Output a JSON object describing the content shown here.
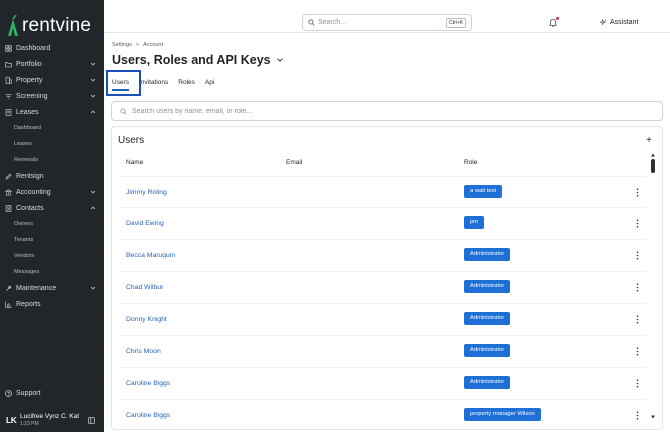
{
  "app": {
    "name": "rentvine"
  },
  "sidebar": {
    "items": [
      {
        "label": "Dashboard",
        "icon": "grid-icon",
        "chevron": ""
      },
      {
        "label": "Portfolio",
        "icon": "folder-icon",
        "chevron": "down"
      },
      {
        "label": "Property",
        "icon": "building-icon",
        "chevron": "down"
      },
      {
        "label": "Screening",
        "icon": "filter-icon",
        "chevron": "down"
      },
      {
        "label": "Leases",
        "icon": "document-icon",
        "chevron": "up"
      }
    ],
    "leases_sub": [
      "Dashboard",
      "Leases",
      "Renewals"
    ],
    "items2": [
      {
        "label": "Rentsign",
        "icon": "pen-icon",
        "chevron": ""
      },
      {
        "label": "Accounting",
        "icon": "bank-icon",
        "chevron": "down"
      },
      {
        "label": "Contacts",
        "icon": "contacts-icon",
        "chevron": "up"
      }
    ],
    "contacts_sub": [
      "Owners",
      "Tenants",
      "Vendors",
      "Messages"
    ],
    "items3": [
      {
        "label": "Maintenance",
        "icon": "wrench-icon",
        "chevron": "down"
      },
      {
        "label": "Reports",
        "icon": "chart-icon",
        "chevron": ""
      }
    ],
    "support": "Support",
    "user": {
      "initials": "LK",
      "name": "Lucifree Vynz C. Kat",
      "time": "1:23 PM"
    }
  },
  "topbar": {
    "search_placeholder": "Search...",
    "search_shortcut": "Ctrl+K",
    "assistant": "Assistant"
  },
  "breadcrumb": {
    "parent": "Settings",
    "separator": ">",
    "current": "Account"
  },
  "page": {
    "title": "Users, Roles and API Keys"
  },
  "tabs": [
    {
      "label": "Users",
      "active": true
    },
    {
      "label": "Invitations",
      "active": false
    },
    {
      "label": "Roles",
      "active": false
    },
    {
      "label": "Api",
      "active": false
    }
  ],
  "filter": {
    "placeholder": "Search users by name, email, or role..."
  },
  "users_card": {
    "title": "Users",
    "add": "+",
    "columns": {
      "name": "Name",
      "email": "Email",
      "role": "Role"
    },
    "rows": [
      {
        "name": "Jimmy Roling",
        "email": "",
        "role": "a wait test"
      },
      {
        "name": "David Ewing",
        "email": "",
        "role": "pm"
      },
      {
        "name": "Becca Maruquin",
        "email": "",
        "role": "Administrator"
      },
      {
        "name": "Chad Wilbur",
        "email": "",
        "role": "Administrator"
      },
      {
        "name": "Donny Knight",
        "email": "",
        "role": "Administrator"
      },
      {
        "name": "Chris Moon",
        "email": "",
        "role": "Administrator"
      },
      {
        "name": "Caroline Biggs",
        "email": "",
        "role": "Administrator"
      },
      {
        "name": "Caroline Biggs",
        "email": "",
        "role": "property manager Wilson"
      }
    ]
  },
  "colors": {
    "sidebar_bg": "#21262b",
    "accent": "#1e6fd6",
    "link": "#2a62b8",
    "highlight": "#1a4fb8"
  }
}
